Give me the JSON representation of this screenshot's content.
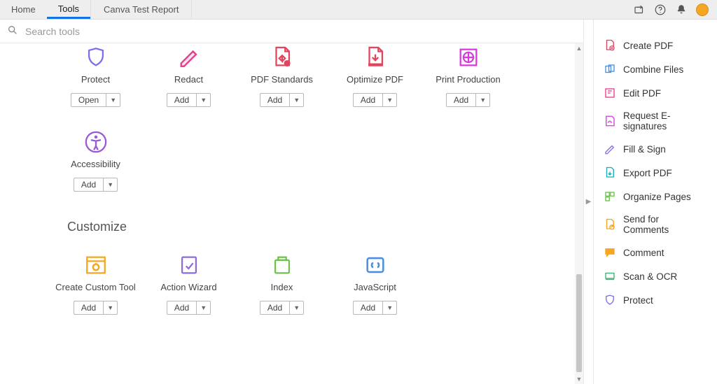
{
  "tabs": {
    "home": "Home",
    "tools": "Tools",
    "doc": "Canva Test Report"
  },
  "search": {
    "placeholder": "Search tools"
  },
  "button": {
    "open": "Open",
    "add": "Add"
  },
  "section": {
    "customize": "Customize"
  },
  "tools_row1": [
    {
      "name": "Protect",
      "action": "open"
    },
    {
      "name": "Redact",
      "action": "add"
    },
    {
      "name": "PDF Standards",
      "action": "add"
    },
    {
      "name": "Optimize PDF",
      "action": "add"
    },
    {
      "name": "Print Production",
      "action": "add"
    }
  ],
  "tools_row2": [
    {
      "name": "Accessibility",
      "action": "add"
    }
  ],
  "tools_row3": [
    {
      "name": "Create Custom Tool",
      "action": "add"
    },
    {
      "name": "Action Wizard",
      "action": "add"
    },
    {
      "name": "Index",
      "action": "add"
    },
    {
      "name": "JavaScript",
      "action": "add"
    }
  ],
  "sidebar": [
    "Create PDF",
    "Combine Files",
    "Edit PDF",
    "Request E-signatures",
    "Fill & Sign",
    "Export PDF",
    "Organize Pages",
    "Send for Comments",
    "Comment",
    "Scan & OCR",
    "Protect"
  ],
  "colors": {
    "protect": "#7a6ff0",
    "redact": "#e83e8c",
    "standards": "#e2445c",
    "optimize": "#e2445c",
    "print": "#d63adf",
    "accessibility": "#9b59d8",
    "custom": "#f5a623",
    "wizard": "#8d6cd9",
    "index": "#6cc24a",
    "js": "#4a90e2"
  }
}
